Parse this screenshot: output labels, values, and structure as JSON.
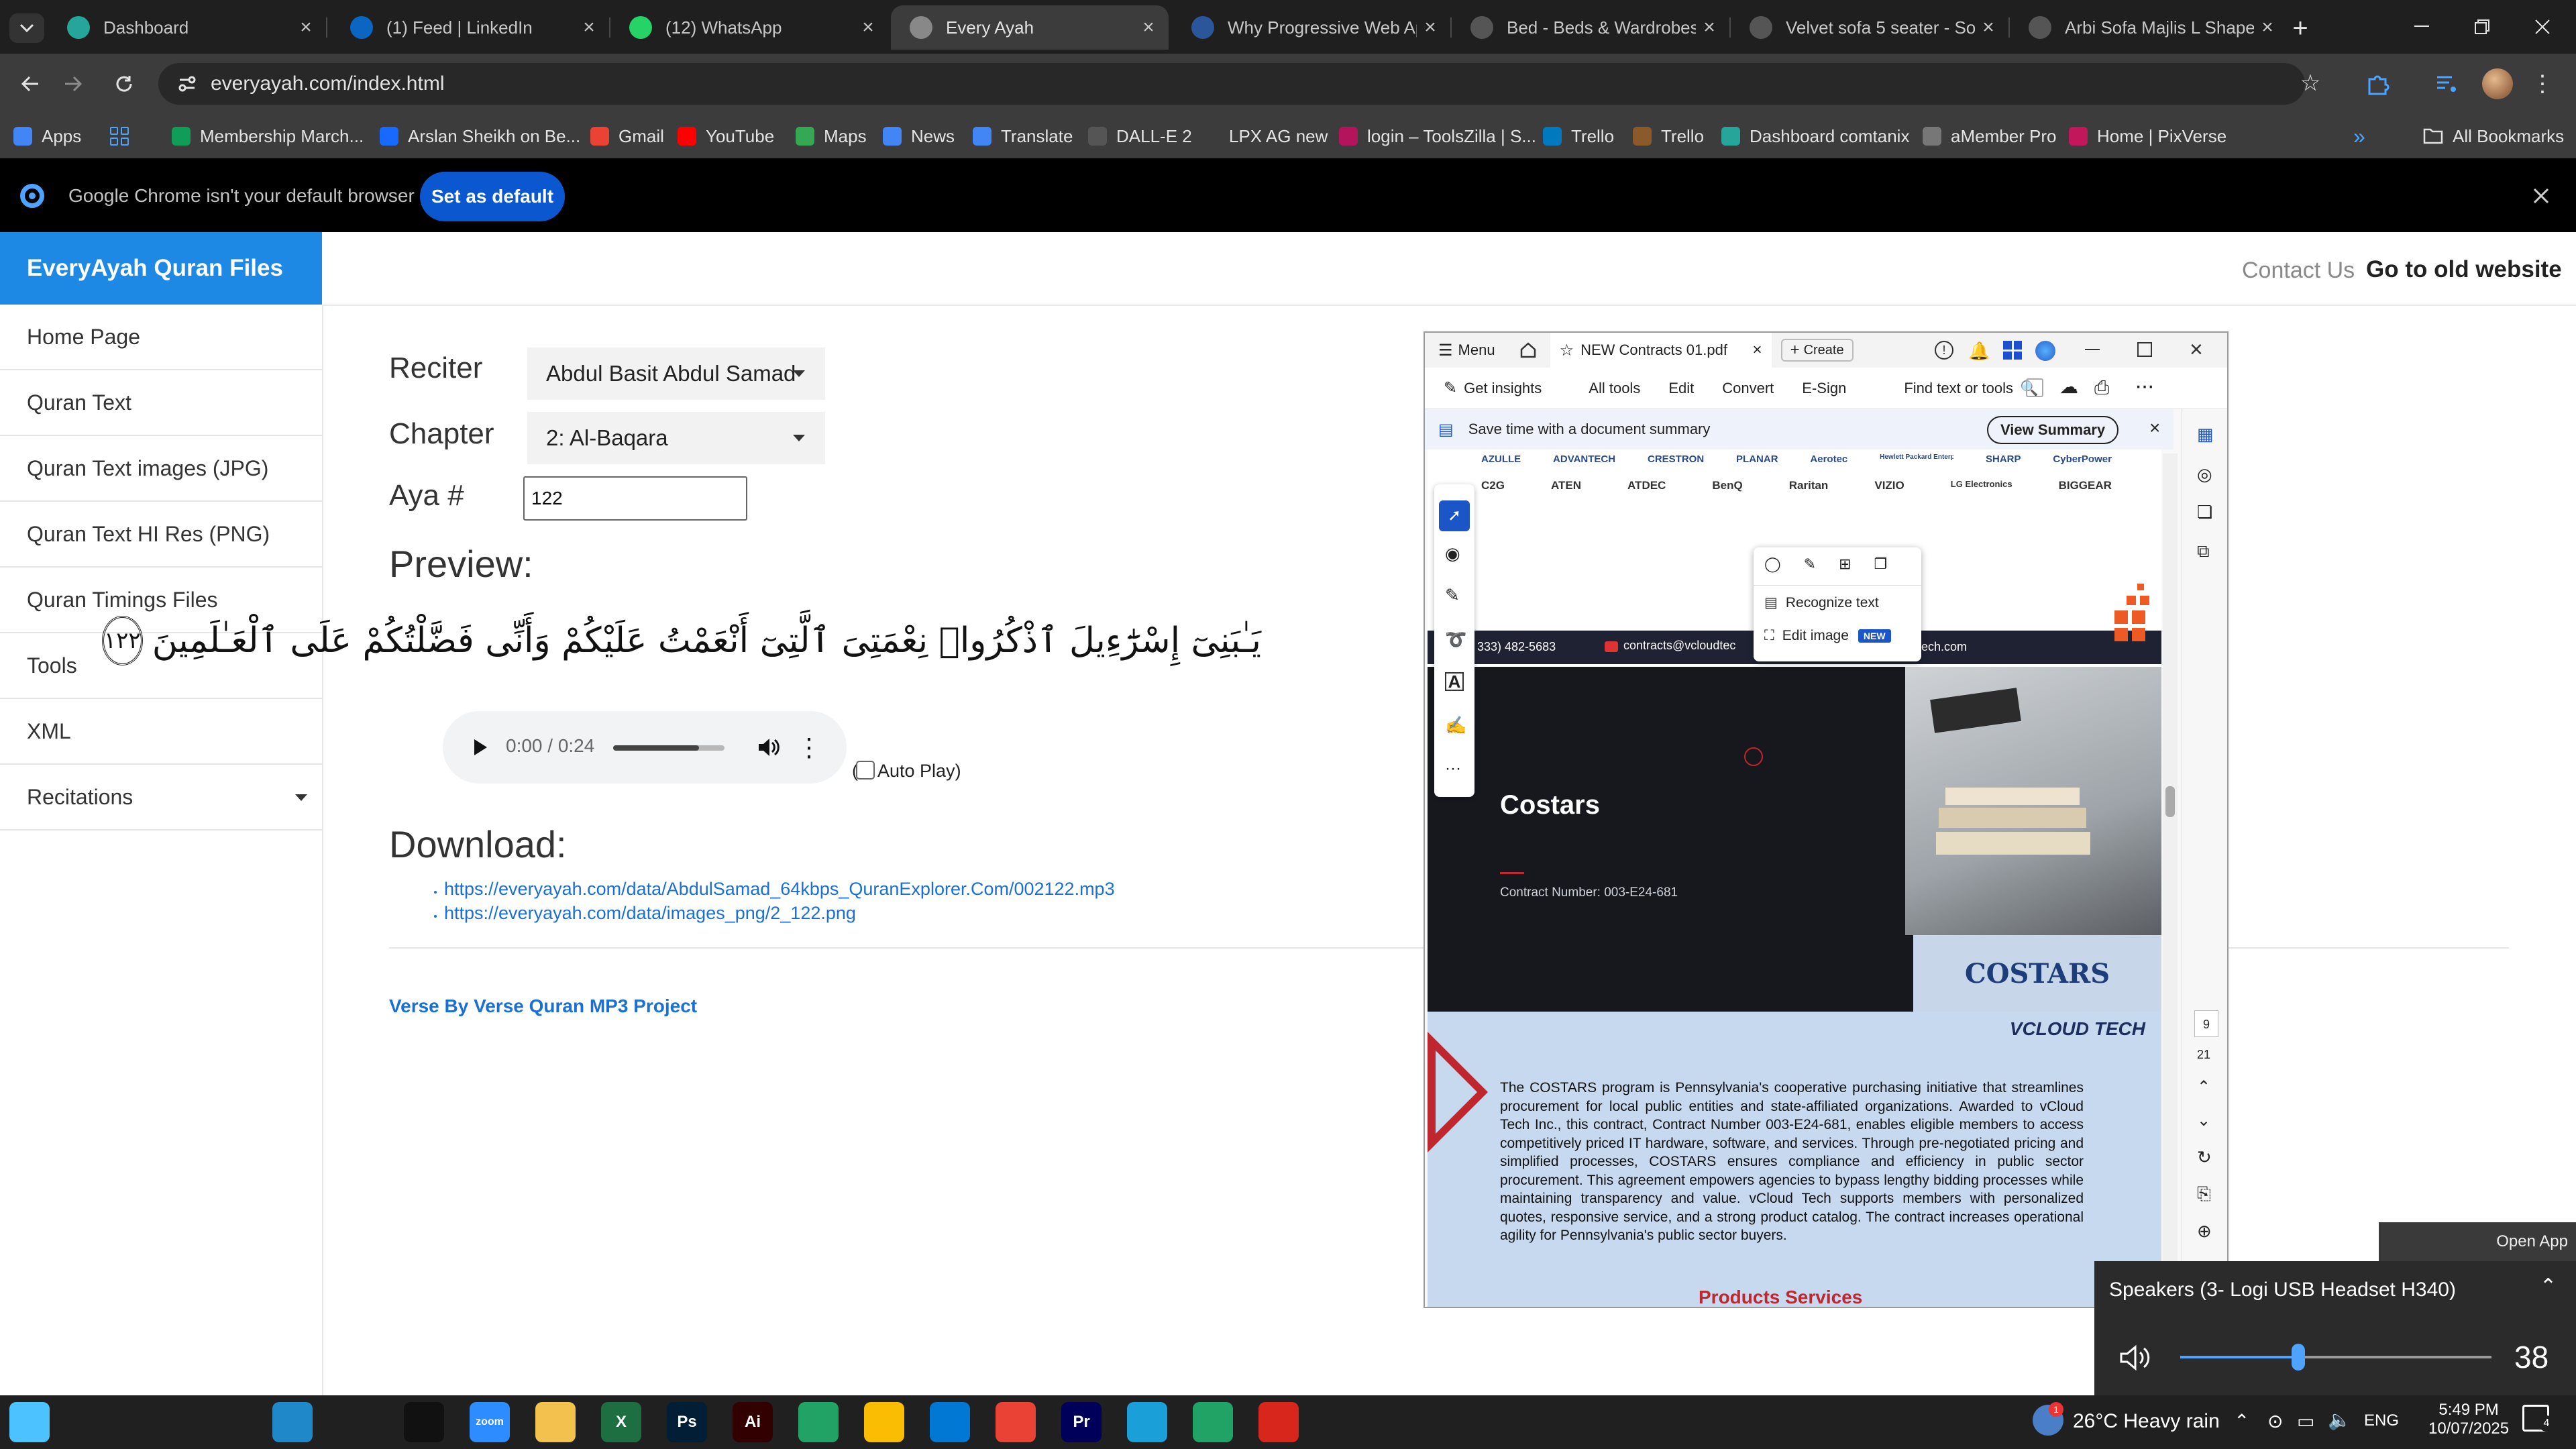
{
  "tabs": [
    {
      "title": "Dashboard",
      "icon": "compass-icon",
      "color": "#26a69a"
    },
    {
      "title": "(1) Feed | LinkedIn",
      "icon": "linkedin-icon",
      "color": "#0a66c2"
    },
    {
      "title": "(12) WhatsApp",
      "icon": "whatsapp-icon",
      "color": "#25d366"
    },
    {
      "title": "Every Ayah",
      "icon": "globe-icon",
      "color": "#888888",
      "active": true
    },
    {
      "title": "Why Progressive Web Ap",
      "icon": "word-icon",
      "color": "#2b579a"
    },
    {
      "title": "Bed - Beds & Wardrobes",
      "icon": "openai-icon",
      "color": "#555555"
    },
    {
      "title": "Velvet sofa 5 seater - Sof",
      "icon": "openai-icon",
      "color": "#555555"
    },
    {
      "title": "Arbi Sofa Majlis L Shape S",
      "icon": "openai-icon",
      "color": "#555555"
    }
  ],
  "address": {
    "url": "everyayah.com/index.html"
  },
  "bookmarks": [
    {
      "label": "Apps",
      "icon": "apps-icon",
      "color": "#4285f4"
    },
    {
      "label": "Membership March...",
      "icon": "sheets-icon",
      "color": "#0f9d58"
    },
    {
      "label": "Arslan Sheikh on Be...",
      "icon": "behance-icon",
      "color": "#1769ff"
    },
    {
      "label": "Gmail",
      "icon": "gmail-icon",
      "color": "#ea4335"
    },
    {
      "label": "YouTube",
      "icon": "youtube-icon",
      "color": "#ff0000"
    },
    {
      "label": "Maps",
      "icon": "maps-icon",
      "color": "#34a853"
    },
    {
      "label": "News",
      "icon": "news-icon",
      "color": "#4285f4"
    },
    {
      "label": "Translate",
      "icon": "translate-icon",
      "color": "#4285f4"
    },
    {
      "label": "DALL-E 2",
      "icon": "openai-icon",
      "color": "#555555"
    },
    {
      "label": "LPX AG new",
      "icon": "globe-icon",
      "color": "#3c3c3c"
    },
    {
      "label": "login – ToolsZilla | S...",
      "icon": "toolszilla-icon",
      "color": "#b4145c"
    },
    {
      "label": "Trello",
      "icon": "trello-icon",
      "color": "#0079bf"
    },
    {
      "label": "Trello",
      "icon": "trello-icon",
      "color": "#8b5a2b"
    },
    {
      "label": "Dashboard comtanix",
      "icon": "compass-icon",
      "color": "#26a69a"
    },
    {
      "label": "aMember Pro",
      "icon": "amember-icon",
      "color": "#777777"
    },
    {
      "label": "Home | PixVerse",
      "icon": "pixverse-icon",
      "color": "#c2185b"
    }
  ],
  "all_bookmarks": "All Bookmarks",
  "infobar": {
    "message": "Google Chrome isn't your default browser",
    "button": "Set as default"
  },
  "site": {
    "brand": "EveryAyah Quran Files",
    "contact": "Contact Us",
    "old_site": "Go to old website",
    "sidebar": [
      "Home Page",
      "Quran Text",
      "Quran Text images (JPG)",
      "Quran Text HI Res (PNG)",
      "Quran Timings Files",
      "Tools",
      "XML",
      "Recitations"
    ],
    "form": {
      "reciter_label": "Reciter",
      "reciter_value": "Abdul Basit Abdul Samad",
      "chapter_label": "Chapter",
      "chapter_value": "2: Al-Baqara",
      "aya_label": "Aya #",
      "aya_value": "122"
    },
    "preview_heading": "Preview:",
    "arabic_text": "يَـٰبَنِىٓ إِسْرَٰٓءِيلَ ٱذْكُرُوا۟ نِعْمَتِىَ ٱلَّتِىٓ أَنْعَمْتُ عَلَيْكُمْ وَأَنِّى فَضَّلْتُكُمْ عَلَى ٱلْعَـٰلَمِينَ",
    "ayah_number": "١٢٢",
    "audio_time": "0:00 / 0:24",
    "autoplay_label": "Auto Play)",
    "autoplay_paren": "(",
    "download_heading": "Download:",
    "downloads": [
      "https://everyayah.com/data/AbdulSamad_64kbps_QuranExplorer.Com/002122.mp3",
      "https://everyayah.com/data/images_png/2_122.png"
    ],
    "footer_link": "Verse By Verse Quran MP3 Project"
  },
  "pdf": {
    "menu": "Menu",
    "tab_title": "NEW Contracts 01.pdf",
    "create": "Create",
    "get_insights": "Get insights",
    "toolbar": [
      "All tools",
      "Edit",
      "Convert",
      "E-Sign"
    ],
    "find": "Find text or tools",
    "summary_text": "Save time with a document summary",
    "view_summary": "View Summary",
    "brands_row1": [
      "AZULLE",
      "ADVANTECH",
      "CRESTRON",
      "PLANAR",
      "Aerotec",
      "Hewlett Packard Enterprise",
      "SHARP",
      "CyberPower"
    ],
    "brands_row2": [
      "C2G",
      "ATEN",
      "ATDEC",
      "BenQ",
      "Raritan",
      "VIZIO",
      "LG Electronics",
      "BIGGEAR"
    ],
    "contact_phone": "333) 482-5683",
    "contact_email": "contracts@vcloudtec",
    "contact_web": "ctech.com",
    "menu_items": [
      "Recognize text",
      "Edit image"
    ],
    "new_badge": "NEW",
    "costars_title": "Costars",
    "contract_number": "Contract Number: 003-E24-681",
    "costars_logo": "COSTARS",
    "vcloud_logo": "VCLOUD TECH",
    "body_text": "The COSTARS program is Pennsylvania's cooperative purchasing initiative that streamlines procurement for local public entities and state-affiliated organizations. Awarded to vCloud Tech Inc., this contract, Contract Number 003-E24-681, enables eligible members to access competitively priced IT hardware, software, and services. Through pre-negotiated pricing and simplified processes, COSTARS ensures compliance and efficiency in public sector procurement. This agreement empowers agencies to bypass lengthy bidding processes while maintaining transparency and value. vCloud Tech supports members with personalized quotes, responsive service, and a strong product catalog. The contract increases operational agility for Pennsylvania's public sector buyers.",
    "products_heading": "Products Services",
    "page_current": "9",
    "page_total": "21"
  },
  "volume": {
    "open_app": "Open App",
    "device": "Speakers (3- Logi USB Headset H340)",
    "level": 38
  },
  "taskbar": {
    "weather": "26°C  Heavy rain",
    "lang": "ENG",
    "time": "5:49 PM",
    "date": "10/07/2025",
    "notif_count": "4",
    "apps": [
      {
        "icon": "windows-icon",
        "color": "#4cc2ff"
      },
      {
        "icon": "search-icon",
        "color": "#202020"
      },
      {
        "icon": "cortana-icon",
        "color": "#202020"
      },
      {
        "icon": "task-view-icon",
        "color": "#202020"
      },
      {
        "icon": "edge-icon",
        "color": "#1e88c8"
      },
      {
        "icon": "pen-icon",
        "color": "#202020"
      },
      {
        "icon": "terminal-icon",
        "color": "#111111"
      },
      {
        "icon": "zoom-icon",
        "color": "#2d8cff",
        "label": "zoom"
      },
      {
        "icon": "folder-icon",
        "color": "#f2c14e"
      },
      {
        "icon": "excel-icon",
        "color": "#1d6f42",
        "label": "X"
      },
      {
        "icon": "photoshop-icon",
        "color": "#001e36",
        "label": "Ps"
      },
      {
        "icon": "illustrator-icon",
        "color": "#330000",
        "label": "Ai"
      },
      {
        "icon": "sheets-green-icon",
        "color": "#21a366"
      },
      {
        "icon": "chrome-icon",
        "color": "#fbbc04"
      },
      {
        "icon": "vscode-icon",
        "color": "#0078d4"
      },
      {
        "icon": "chrome-profile-icon",
        "color": "#ea4335"
      },
      {
        "icon": "premiere-icon",
        "color": "#00005b",
        "label": "Pr"
      },
      {
        "icon": "app-diamond-icon",
        "color": "#1a9fd9"
      },
      {
        "icon": "sheets-green-icon",
        "color": "#21a366"
      },
      {
        "icon": "acrobat-icon",
        "color": "#d9261c"
      }
    ]
  }
}
